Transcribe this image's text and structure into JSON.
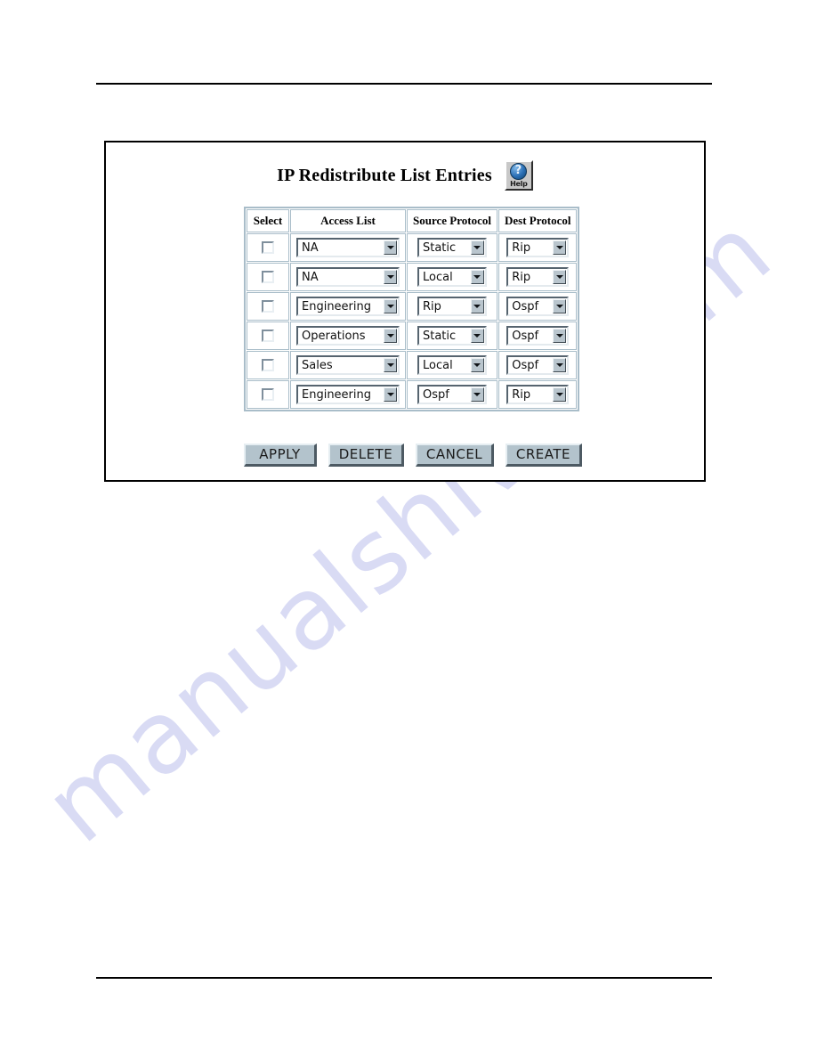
{
  "page": {
    "watermark_text": "manualshive.com",
    "rule_color": "#000000"
  },
  "panel": {
    "title": "IP Redistribute List Entries",
    "help_icon": {
      "name": "help-icon",
      "glyph": "?",
      "caption": "Help"
    }
  },
  "table": {
    "columns": [
      {
        "key": "select",
        "label": "Select"
      },
      {
        "key": "access_list",
        "label": "Access List"
      },
      {
        "key": "source_protocol",
        "label": "Source Protocol"
      },
      {
        "key": "dest_protocol",
        "label": "Dest Protocol"
      }
    ],
    "rows": [
      {
        "select": false,
        "access_list": "NA",
        "source_protocol": "Static",
        "dest_protocol": "Rip"
      },
      {
        "select": false,
        "access_list": "NA",
        "source_protocol": "Local",
        "dest_protocol": "Rip"
      },
      {
        "select": false,
        "access_list": "Engineering",
        "source_protocol": "Rip",
        "dest_protocol": "Ospf"
      },
      {
        "select": false,
        "access_list": "Operations",
        "source_protocol": "Static",
        "dest_protocol": "Ospf"
      },
      {
        "select": false,
        "access_list": "Sales",
        "source_protocol": "Local",
        "dest_protocol": "Ospf"
      },
      {
        "select": false,
        "access_list": "Engineering",
        "source_protocol": "Ospf",
        "dest_protocol": "Rip"
      }
    ]
  },
  "buttons": [
    {
      "key": "apply",
      "label": "APPLY"
    },
    {
      "key": "delete",
      "label": "DELETE"
    },
    {
      "key": "cancel",
      "label": "CANCEL"
    },
    {
      "key": "create",
      "label": "CREATE"
    }
  ],
  "colors": {
    "table_border": "#a9bdc9",
    "button_face": "#b3c3cc",
    "help_disc": "#2a6fb5",
    "watermark": "#d9dbf4"
  }
}
